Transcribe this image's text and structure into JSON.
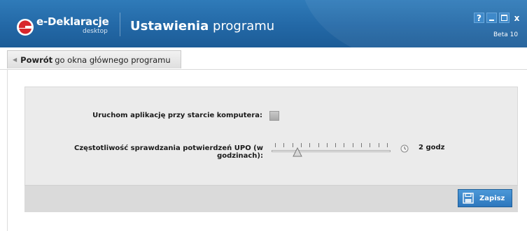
{
  "header": {
    "logo_text": "e-Deklaracje",
    "logo_subtext": "desktop",
    "title_bold": "Ustawienia",
    "title_light": "programu",
    "window_buttons": {
      "help": "?",
      "minimize": "_",
      "maximize": "□",
      "close": "x"
    },
    "version_label": "Beta 10"
  },
  "tabbar": {
    "back_bold": "Powrót",
    "back_rest": "go okna głównego programu"
  },
  "settings": {
    "autostart_label": "Uruchom aplikację przy starcie komputera:",
    "autostart_checked": false,
    "upo_frequency_label": "Częstotliwość sprawdzania potwierdzeń UPO (w godzinach):",
    "upo_frequency_value": 2,
    "upo_frequency_min": 1,
    "upo_frequency_max": 14,
    "upo_frequency_display": "2 godz"
  },
  "footer": {
    "save_label": "Zapisz"
  },
  "icons": {
    "logo": "e-deklaracje-logo-icon",
    "back": "back-arrow-icon",
    "clock": "clock-icon",
    "save": "floppy-disk-icon"
  },
  "colors": {
    "header_blue": "#2368a6",
    "button_blue": "#2d77bd",
    "logo_red": "#d8262c"
  }
}
